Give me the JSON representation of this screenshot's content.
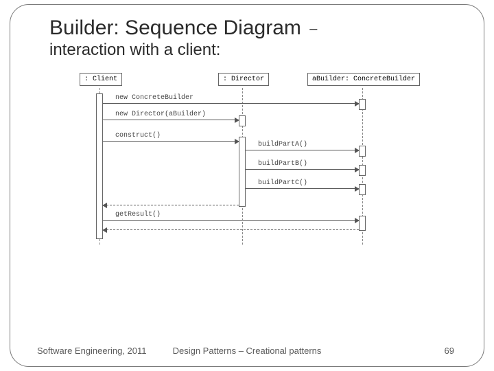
{
  "title": {
    "main": "Builder: Sequence Diagram",
    "dash": "–",
    "subtitle": "interaction with a client:"
  },
  "footer": {
    "left": "Software Engineering, 2011",
    "center": "Design Patterns – Creational patterns",
    "right": "69"
  },
  "diagram": {
    "participants": {
      "client": ": Client",
      "director": ": Director",
      "builder": "aBuilder: ConcreteBuilder"
    },
    "messages": {
      "m1": "new ConcreteBuilder",
      "m2": "new Director(aBuilder)",
      "m3": "construct()",
      "m4": "buildPartA()",
      "m5": "buildPartB()",
      "m6": "buildPartC()",
      "m7": "getResult()"
    }
  }
}
